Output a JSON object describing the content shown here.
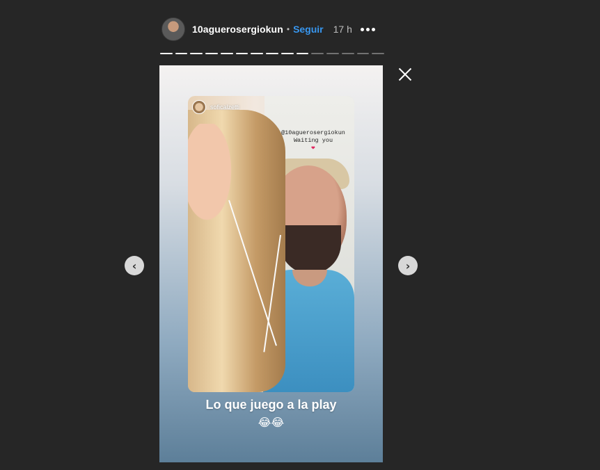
{
  "header": {
    "username": "10aguerosergiokun",
    "separator": "•",
    "follow_label": "Seguir",
    "time": "17 h"
  },
  "progress": {
    "total_segments": 15,
    "current_segment": 10
  },
  "story": {
    "inner_username": "soficalzetti",
    "caption_line1": "@10aguerosergiokun",
    "caption_line2": "Waiting you",
    "caption_heart": "❤",
    "text": "Lo que juego a la play",
    "emojis": "😂😂"
  },
  "nav": {
    "prev_symbol": "‹",
    "next_symbol": "›"
  },
  "icons": {
    "close": "close-icon",
    "more": "more-options-icon",
    "prev": "chevron-left-icon",
    "next": "chevron-right-icon"
  },
  "colors": {
    "background": "#262626",
    "accent": "#3897f0"
  }
}
